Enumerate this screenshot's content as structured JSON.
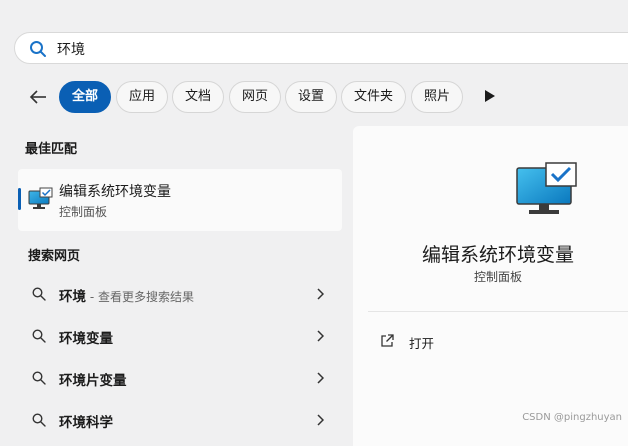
{
  "search": {
    "query": "环境"
  },
  "filters": {
    "tabs": [
      {
        "label": "全部"
      },
      {
        "label": "应用"
      },
      {
        "label": "文档"
      },
      {
        "label": "网页"
      },
      {
        "label": "设置"
      },
      {
        "label": "文件夹"
      },
      {
        "label": "照片"
      }
    ],
    "active_index": 0
  },
  "best_match": {
    "section_title": "最佳匹配",
    "title": "编辑系统环境变量",
    "subtitle": "控制面板",
    "icon": "monitor-check-icon"
  },
  "web_search": {
    "section_title": "搜索网页",
    "results": [
      {
        "term": "环境",
        "hint": " - 查看更多搜索结果"
      },
      {
        "term": "环境变量",
        "hint": ""
      },
      {
        "term": "环境片变量",
        "hint": ""
      },
      {
        "term": "环境科学",
        "hint": ""
      }
    ]
  },
  "detail": {
    "title": "编辑系统环境变量",
    "subtitle": "控制面板",
    "actions": [
      {
        "label": "打开",
        "icon": "open-external-icon"
      }
    ]
  },
  "watermark": "CSDN @pingzhuyan",
  "colors": {
    "accent": "#0a5fb4",
    "background": "#f0f0f1"
  }
}
